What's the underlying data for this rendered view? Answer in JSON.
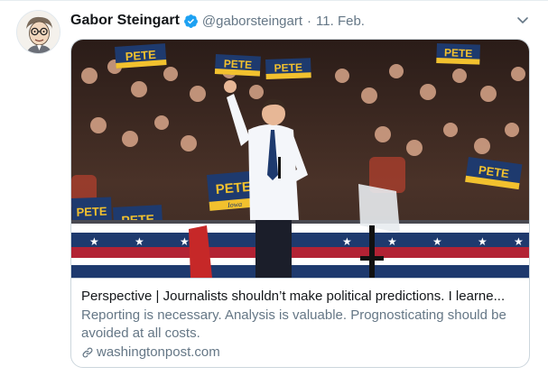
{
  "tweet": {
    "author_name": "Gabor Steingart",
    "handle": "@gaborsteingart",
    "separator": "·",
    "date": "11. Feb.",
    "verified": true
  },
  "card": {
    "sign_text": "PETE",
    "sign_subtext": "Iowa",
    "title": "Perspective | Journalists shouldn’t make political predictions. I learne...",
    "description": "Reporting is necessary. Analysis is valuable. Prognosticating should be avoided at all costs.",
    "domain": "washingtonpost.com"
  },
  "icons": {
    "verified": "verified-badge-icon",
    "menu": "chevron-down-icon",
    "link": "link-icon"
  },
  "colors": {
    "verified_blue": "#1da1f2",
    "secondary_text": "#657786",
    "sign_blue": "#1e3a6e",
    "sign_yellow": "#f2c12e"
  }
}
